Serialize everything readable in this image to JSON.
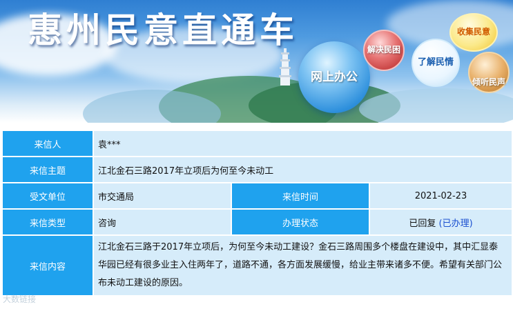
{
  "banner": {
    "site_title": "惠州民意直通车",
    "bubbles": {
      "online": "网上办公",
      "solve": "解决民困",
      "understand": "了解民情",
      "collect": "收集民意",
      "listen": "倾听民声"
    }
  },
  "letter": {
    "sender_label": "来信人",
    "sender_value": "袁***",
    "subject_label": "来信主题",
    "subject_value": "江北金石三路2017年立项后为何至今未动工",
    "unit_label": "受文单位",
    "unit_value": "市交通局",
    "time_label": "来信时间",
    "time_value": "2021-02-23",
    "type_label": "来信类型",
    "type_value": "咨询",
    "status_label": "办理状态",
    "status_value": "已回复",
    "status_link": "(已办理)",
    "content_label": "来信内容",
    "content_value": "江北金石三路于2017年立项后，为何至今未动工建设？金石三路周围多个楼盘在建设中，其中汇显泰华园已经有很多业主入住两年了，道路不通，各方面发展缓慢，给业主带来诸多不便。希望有关部门公布未动工建设的原因。"
  },
  "watermark": "大数链接",
  "colors": {
    "label_bg": "#1fa2ee",
    "value_bg": "#d6ecfa",
    "link": "#1a4fd0"
  }
}
